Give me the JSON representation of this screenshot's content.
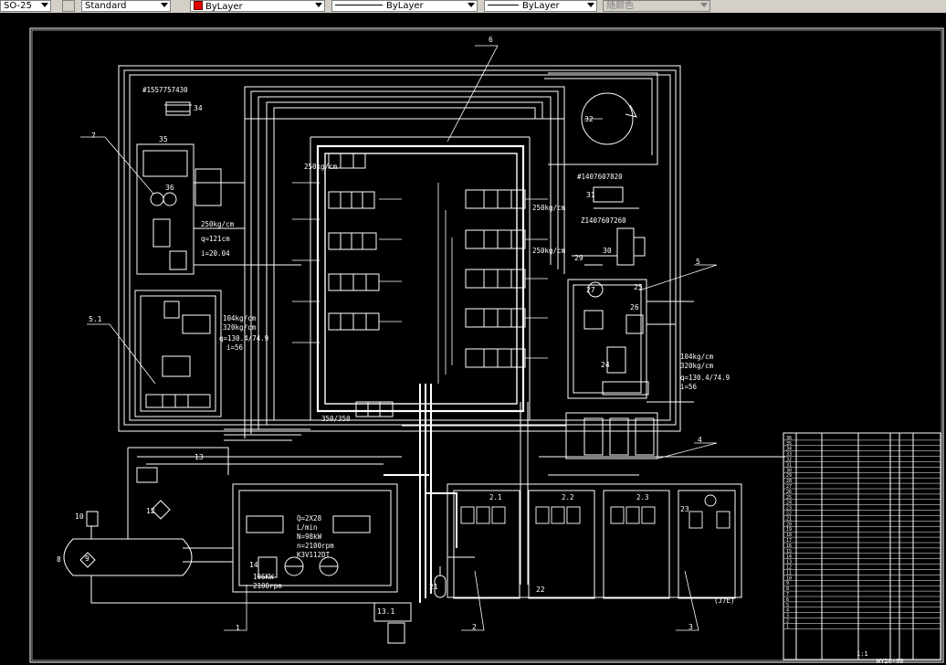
{
  "toolbar": {
    "dimstyle": "SO-25",
    "textstyle": "Standard",
    "color": "ByLayer",
    "linetype": "ByLayer",
    "lineweight": "ByLayer",
    "plotstyle": "随颜色",
    "color_swatch": "#e00000"
  },
  "drawing": {
    "callouts": {
      "c1": "1",
      "c2": "2",
      "c3": "3",
      "c4": "4",
      "c5": "5",
      "c51": "5.1",
      "c6": "6",
      "c7": "7",
      "c8": "8",
      "c9": "9",
      "c10": "10",
      "c12": "12",
      "c13": "13",
      "c14": "14",
      "c21": "21",
      "c22": "22",
      "c23": "23",
      "c24": "24",
      "c25": "25",
      "c26": "26",
      "c27": "27",
      "c29": "29",
      "c30": "30",
      "c31": "31",
      "c32": "32",
      "c34": "34",
      "c35": "35",
      "c36": "36",
      "c131": "13.1"
    },
    "notes": {
      "part34": "#1557757430",
      "part31": "#1407607820",
      "part30": "Z1407607260",
      "valve_top": "250kg/cm",
      "valve_mid": "250kg/cm",
      "main_valve": "350/350",
      "left_p1": "250kg/cm",
      "left_p2": "q=121cm",
      "left_p3": "i=20.04",
      "mid_p1": "104kg/cm",
      "mid_p2": "320kg/cm",
      "mid_p3": "q=130.4/74.9",
      "mid_p4": "i=56",
      "right_p1": "104kg/cm",
      "right_p2": "320kg/cm",
      "right_p3": "q=130.4/74.9",
      "right_p4": "i=56",
      "pump1": "Q=2X28",
      "pump2": "L/min",
      "pump3": "N=98kW",
      "pump4": "n=2100rpm",
      "pump5": "K3V112DT",
      "motor1": "106KW",
      "motor2": "2100rpm",
      "label_2_1": "2.1",
      "label_2_2": "2.2",
      "label_2_3": "2.3",
      "bottom_note": "(J7E)"
    },
    "title_block": {
      "drawing_no": "WY20-00",
      "scale": "1:1",
      "rows": [
        "1",
        "2",
        "3",
        "4",
        "5",
        "6",
        "7",
        "8",
        "9",
        "10",
        "11",
        "12",
        "13",
        "14",
        "15",
        "16",
        "17",
        "18",
        "19",
        "20",
        "21",
        "22",
        "23",
        "24",
        "25",
        "26",
        "27",
        "28",
        "29",
        "30",
        "31",
        "32",
        "33",
        "34",
        "35",
        "36"
      ]
    }
  }
}
